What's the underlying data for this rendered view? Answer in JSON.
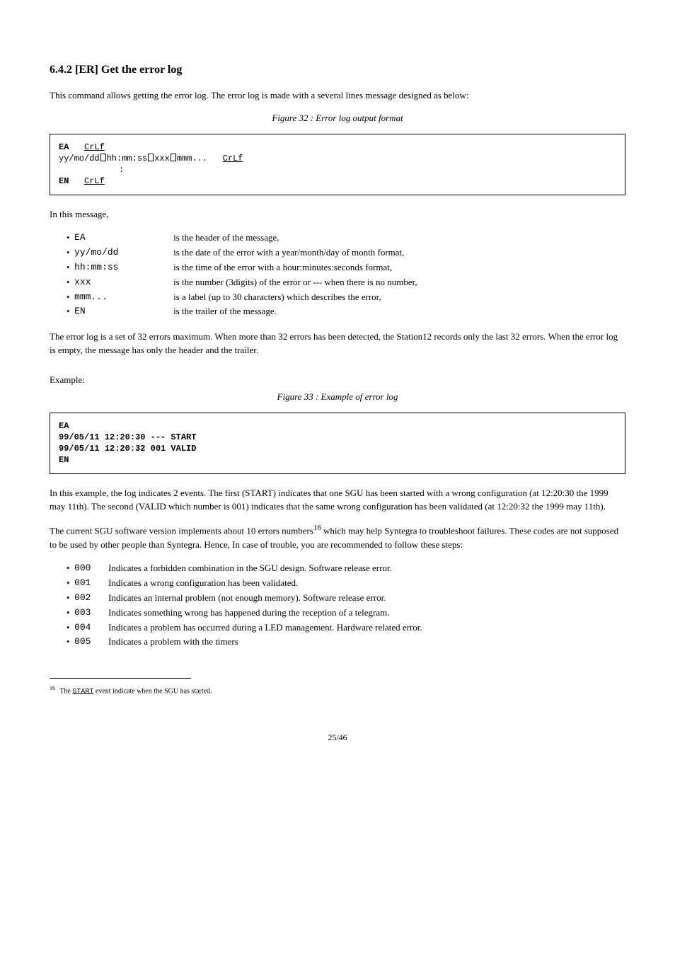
{
  "section_title": "6.4.2 [ER] Get the error log",
  "intro": "This command allows getting the error log. The error log is made with a several lines message designed as below:",
  "format_caption": "Figure 32 : Error log output format",
  "format": {
    "l1_bold": "EA",
    "l1_crlf": "CrLf",
    "l2_a": "yy/mo/dd",
    "l2_b": "hh:mm:ss",
    "l2_c": "xxx",
    "l2_d": "mmm...",
    "l2_crlf": "CrLf",
    "colon": ":",
    "l3_bold": "EN",
    "l3_crlf": "CrLf"
  },
  "legend_intro": "In this message,",
  "legend": [
    {
      "term": "EA",
      "desc": "is the header of the message,"
    },
    {
      "term": "yy/mo/dd",
      "desc": "is the date of the error with a year/month/day of month format,"
    },
    {
      "term": "hh:mm:ss",
      "desc": "is the time of the error with a hour:minutes:seconds format,"
    },
    {
      "term": "xxx",
      "desc": "is the number (3digits) of the error or --- when there is no number,"
    },
    {
      "term": "mmm...",
      "desc": "is a label (up to 30 characters) which describes the error,"
    },
    {
      "term": "EN",
      "desc": "is the trailer of the message."
    }
  ],
  "note": "The error log is a set of 32 errors maximum. When more than 32 errors has been detected, the Station12 records only the last 32 errors. When the error log is empty, the message has only the header and the trailer.",
  "example_label": "Example:",
  "example_lines": [
    "EA",
    "99/05/11 12:20:30 --- START",
    "99/05/11 12:20:32 001 VALID",
    "EN"
  ],
  "example_caption": "Figure 33 : Example of error log",
  "example_explain": "In this example, the log indicates 2 events. The first (START) indicates that one SGU has been started with a wrong configuration (at 12:20:30 the 1999 may 11th). The second (VALID which number is 001) indicates that the same wrong configuration has been validated (at 12:20:32 the 1999 may 11th).",
  "codes_intro_a": "The current SGU software version implements about 10 errors numbers",
  "codes_intro_b": " which may help Syntegra to",
  "codes_intro_c": "troubleshoot failures. These codes are not supposed to be used by other people than Syntegra. Hence, In case of trouble, you are recommended to follow these steps:",
  "codes": [
    [
      "000",
      "Indicates a forbidden combination in the SGU design. Software release error."
    ],
    [
      "001",
      "Indicates a wrong configuration has been validated."
    ],
    [
      "002",
      "Indicates an internal problem (not enough memory). Software release error."
    ],
    [
      "003",
      "Indicates something wrong has happened during the reception of a telegram."
    ],
    [
      "004",
      "Indicates a problem has occurred during a LED management. Hardware related error."
    ],
    [
      "005",
      "Indicates a problem with the timers"
    ]
  ],
  "footnote_num": "16",
  "footnote_a": "The ",
  "footnote_b": "START",
  "footnote_c": " event indicate when the SGU has started.",
  "page_number": "25/46"
}
